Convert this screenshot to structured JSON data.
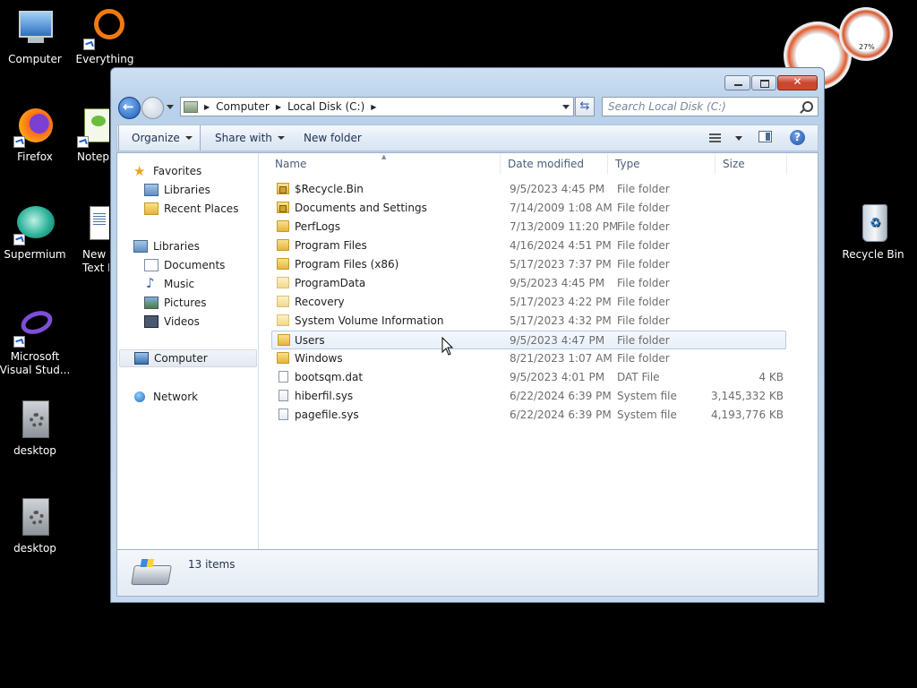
{
  "desktop": {
    "icons": [
      {
        "label": "Computer"
      },
      {
        "label": "Everything"
      },
      {
        "label": "Firefox"
      },
      {
        "label": "Notepa"
      },
      {
        "label": "Supermium"
      },
      {
        "label": "New F\nText D"
      },
      {
        "label": "Microsoft\nVisual Stud..."
      },
      {
        "label": "desktop"
      },
      {
        "label": "desktop"
      },
      {
        "label": "Recycle Bin"
      }
    ],
    "gadget_cpu_percent": "27%"
  },
  "window": {
    "address": {
      "crumbs": [
        "Computer",
        "Local Disk (C:)"
      ]
    },
    "search": {
      "placeholder": "Search Local Disk (C:)"
    },
    "toolbar": {
      "organize": "Organize",
      "share_with": "Share with",
      "new_folder": "New folder",
      "help": "?"
    },
    "nav": {
      "favorites": "Favorites",
      "libraries_fav": "Libraries",
      "recent_places": "Recent Places",
      "libraries": "Libraries",
      "documents": "Documents",
      "music": "Music",
      "pictures": "Pictures",
      "videos": "Videos",
      "computer": "Computer",
      "network": "Network"
    },
    "columns": {
      "name": "Name",
      "date": "Date modified",
      "type": "Type",
      "size": "Size"
    },
    "files": [
      {
        "name": "$Recycle.Bin",
        "date": "9/5/2023 4:45 PM",
        "type": "File folder",
        "size": "",
        "icon": "folder-locked"
      },
      {
        "name": "Documents and Settings",
        "date": "7/14/2009 1:08 AM",
        "type": "File folder",
        "size": "",
        "icon": "folder-locked"
      },
      {
        "name": "PerfLogs",
        "date": "7/13/2009 11:20 PM",
        "type": "File folder",
        "size": "",
        "icon": "folder"
      },
      {
        "name": "Program Files",
        "date": "4/16/2024 4:51 PM",
        "type": "File folder",
        "size": "",
        "icon": "folder"
      },
      {
        "name": "Program Files (x86)",
        "date": "5/17/2023 7:37 PM",
        "type": "File folder",
        "size": "",
        "icon": "folder"
      },
      {
        "name": "ProgramData",
        "date": "9/5/2023 4:45 PM",
        "type": "File folder",
        "size": "",
        "icon": "folder-light"
      },
      {
        "name": "Recovery",
        "date": "5/17/2023 4:22 PM",
        "type": "File folder",
        "size": "",
        "icon": "folder-light"
      },
      {
        "name": "System Volume Information",
        "date": "5/17/2023 4:32 PM",
        "type": "File folder",
        "size": "",
        "icon": "folder-light"
      },
      {
        "name": "Users",
        "date": "9/5/2023 4:47 PM",
        "type": "File folder",
        "size": "",
        "icon": "folder"
      },
      {
        "name": "Windows",
        "date": "8/21/2023 1:07 AM",
        "type": "File folder",
        "size": "",
        "icon": "folder"
      },
      {
        "name": "bootsqm.dat",
        "date": "9/5/2023 4:01 PM",
        "type": "DAT File",
        "size": "4 KB",
        "icon": "file"
      },
      {
        "name": "hiberfil.sys",
        "date": "6/22/2024 6:39 PM",
        "type": "System file",
        "size": "3,145,332 KB",
        "icon": "sysfile"
      },
      {
        "name": "pagefile.sys",
        "date": "6/22/2024 6:39 PM",
        "type": "System file",
        "size": "4,193,776 KB",
        "icon": "sysfile"
      }
    ],
    "hovered_row": "Users",
    "status": {
      "items_count": "13 items"
    }
  },
  "colors": {
    "window_frame": "#b9d1ea",
    "selection": "#e7eff9",
    "desktop": "#000000"
  }
}
